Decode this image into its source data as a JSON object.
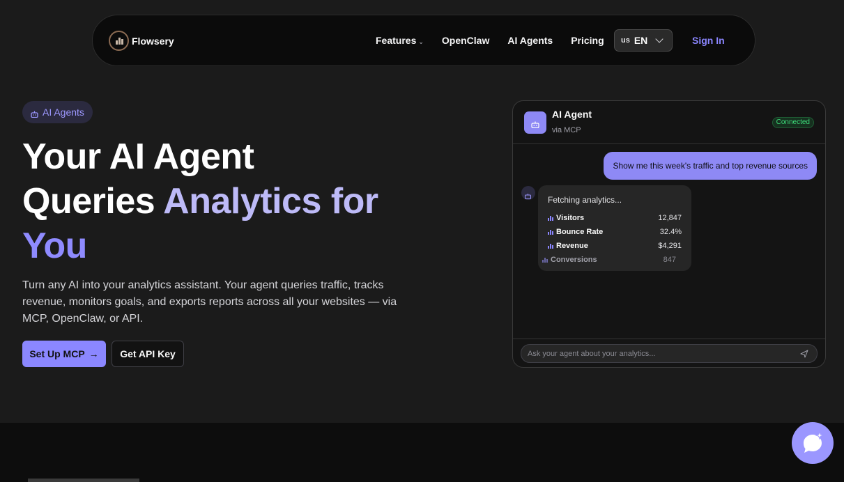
{
  "nav": {
    "brand": "Flowsery",
    "links": [
      {
        "label": "Features",
        "has_dropdown": true
      },
      {
        "label": "OpenClaw"
      },
      {
        "label": "AI Agents"
      },
      {
        "label": "Pricing"
      }
    ],
    "language": {
      "flag": "us",
      "code": "EN"
    },
    "sign_in": "Sign In"
  },
  "hero": {
    "badge": "AI Agents",
    "title_line1": "Your AI Agent",
    "title_line2_plain": "Queries ",
    "title_line2_accent": "Analytics for",
    "title_line3_accent": "You",
    "description": "Turn any AI into your analytics assistant. Your agent queries traffic, tracks revenue, monitors goals, and exports reports across all your websites — via MCP, OpenClaw, or API.",
    "primary_button": "Set Up MCP",
    "primary_button_arrow": "→",
    "secondary_button": "Get API Key"
  },
  "chat": {
    "agent_name": "AI Agent",
    "agent_sub": "via MCP",
    "status": "Connected",
    "user_message": "Show me this week's traffic and top revenue sources",
    "bot_status": "Fetching analytics...",
    "metrics": [
      {
        "label": "Visitors",
        "value": "12,847"
      },
      {
        "label": "Bounce Rate",
        "value": "32.4%"
      },
      {
        "label": "Revenue",
        "value": "$4,291"
      },
      {
        "label": "Conversions",
        "value": "847"
      }
    ],
    "input_placeholder": "Ask your agent about your analytics..."
  },
  "colors": {
    "accent": "#8b87ff",
    "background": "#1b1b1b",
    "connected_green": "#3ddc7a"
  },
  "icons": {
    "logo": "bar-chart-logo-icon",
    "badge": "robot-icon",
    "send": "send-icon",
    "fab": "chat-sparkle-icon"
  }
}
